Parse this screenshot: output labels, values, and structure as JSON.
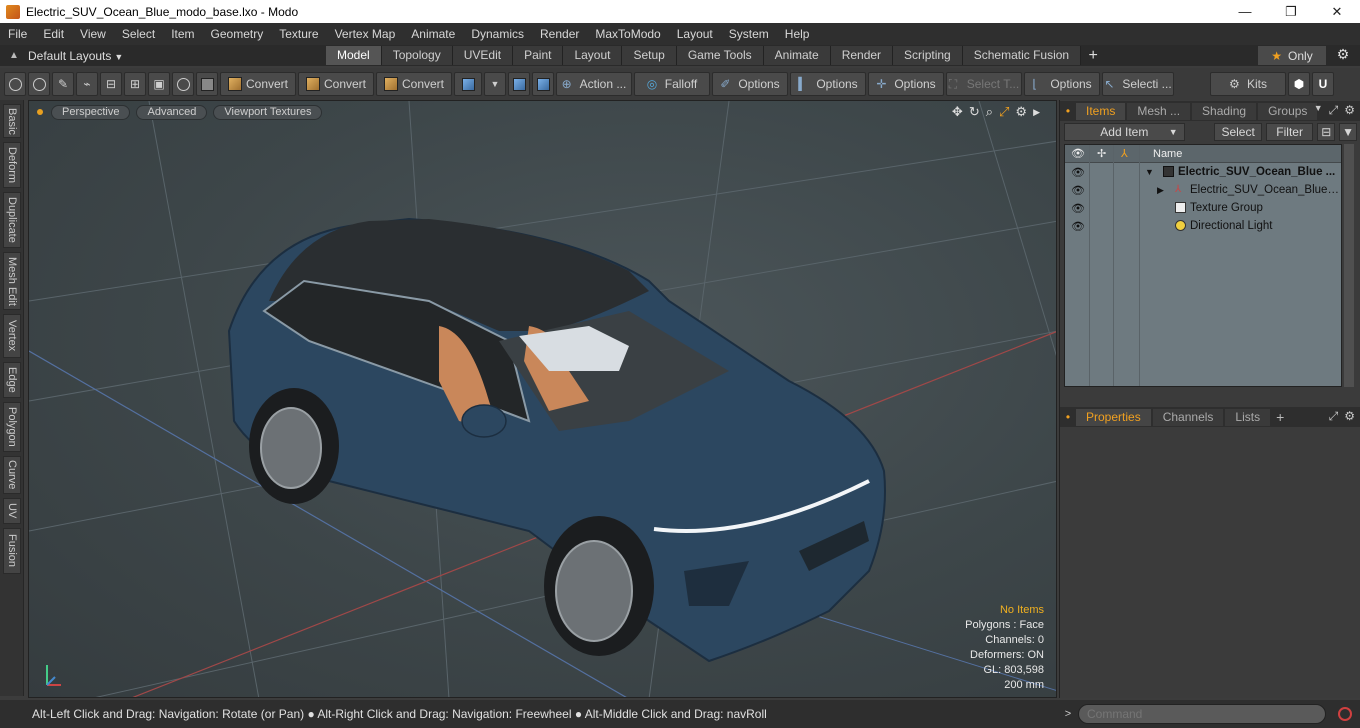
{
  "window": {
    "title": "Electric_SUV_Ocean_Blue_modo_base.lxo - Modo",
    "minimize": "—",
    "maximize": "❐",
    "close": "✕"
  },
  "menu": [
    "File",
    "Edit",
    "View",
    "Select",
    "Item",
    "Geometry",
    "Texture",
    "Vertex Map",
    "Animate",
    "Dynamics",
    "Render",
    "MaxToModo",
    "Layout",
    "System",
    "Help"
  ],
  "layouts": {
    "dropdown": "Default Layouts",
    "tabs": [
      "Model",
      "Topology",
      "UVEdit",
      "Paint",
      "Layout",
      "Setup",
      "Game Tools",
      "Animate",
      "Render",
      "Scripting",
      "Schematic Fusion"
    ],
    "active_tab": "Model",
    "only_label": "Only"
  },
  "toolbar": {
    "convert1": "Convert",
    "convert2": "Convert",
    "convert3": "Convert",
    "action": "Action ...",
    "falloff": "Falloff",
    "options1": "Options",
    "options2": "Options",
    "options3": "Options",
    "select_t": "Select T...",
    "options4": "Options",
    "selecti": "Selecti ...",
    "kits": "Kits"
  },
  "left_tabs": [
    "Basic",
    "Deform",
    "Duplicate",
    "Mesh Edit",
    "Vertex",
    "Edge",
    "Polygon",
    "Curve",
    "UV",
    "Fusion"
  ],
  "viewport": {
    "tabs": [
      "Perspective",
      "Advanced",
      "Viewport Textures"
    ],
    "stats": {
      "no_items": "No Items",
      "polygons": "Polygons : Face",
      "channels": "Channels: 0",
      "deformers": "Deformers: ON",
      "gl": "GL: 803,598",
      "scale": "200 mm"
    }
  },
  "items_panel": {
    "tabs": [
      "Items",
      "Mesh ...",
      "Shading",
      "Groups"
    ],
    "active_tab": "Items",
    "add_item": "Add Item",
    "select": "Select",
    "filter": "Filter",
    "name_header": "Name",
    "rows": [
      {
        "label": "Electric_SUV_Ocean_Blue ...",
        "icon": "scene-icon"
      },
      {
        "label": "Electric_SUV_Ocean_Blue_g ...",
        "icon": "mesh-locator-icon"
      },
      {
        "label": "Texture Group",
        "icon": "texture-group-icon"
      },
      {
        "label": "Directional Light",
        "icon": "light-icon"
      }
    ]
  },
  "props_panel": {
    "tabs": [
      "Properties",
      "Channels",
      "Lists"
    ],
    "active_tab": "Properties"
  },
  "status": {
    "hint": "Alt-Left Click and Drag: Navigation: Rotate (or Pan) ● Alt-Right Click and Drag: Navigation: Freewheel ● Alt-Middle Click and Drag: navRoll",
    "command_placeholder": "Command"
  },
  "colors": {
    "accent": "#f0a020",
    "car_body": "#2e4a63",
    "interior": "#c9875a"
  }
}
